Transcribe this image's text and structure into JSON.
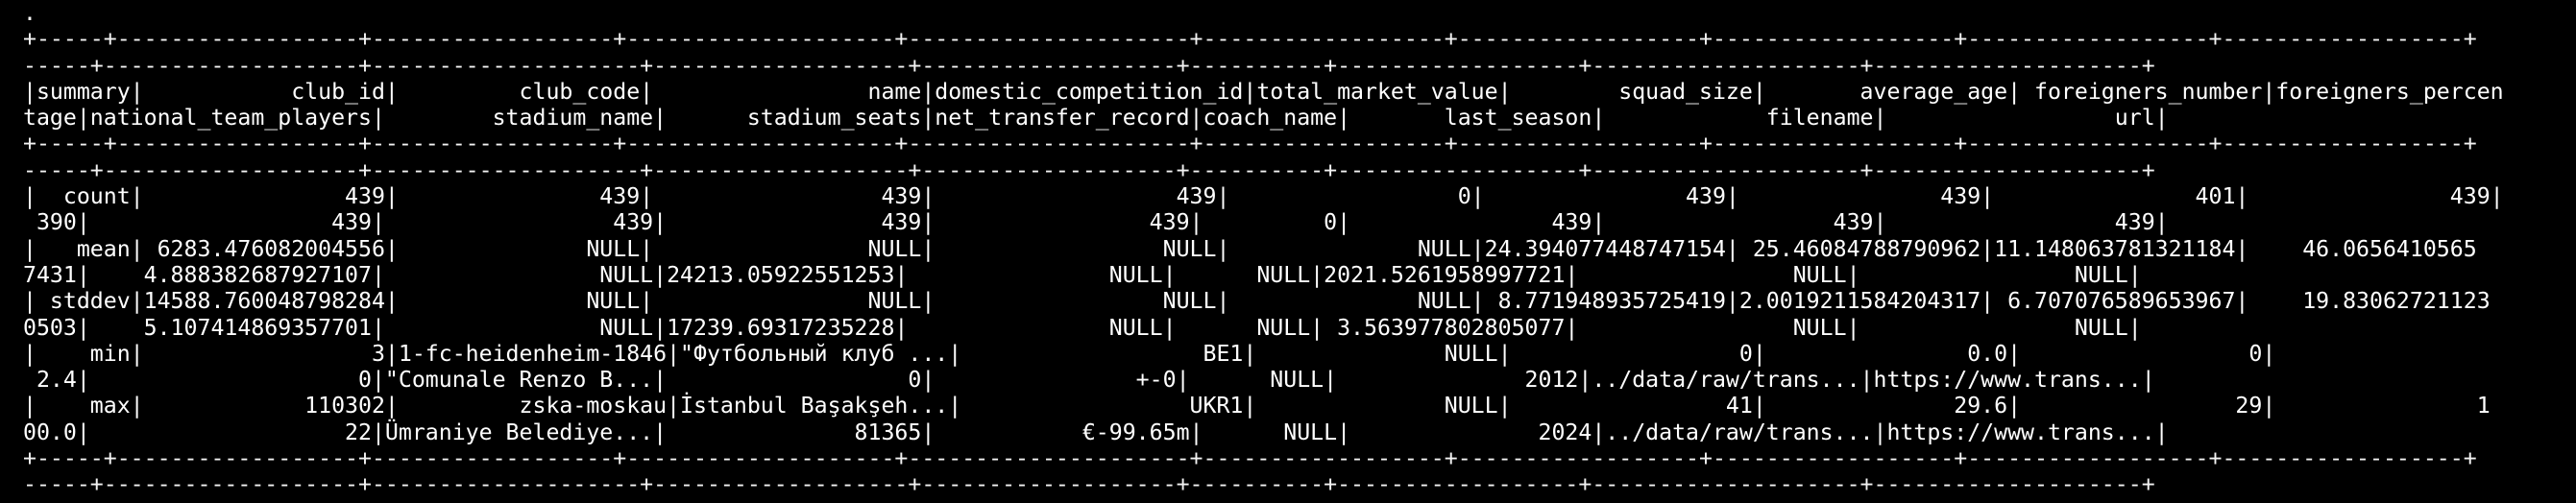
{
  "terminal": {
    "background": "#000000",
    "foreground": "#ffffff",
    "lines": [
      ".",
      "+-----+------------------+------------------+--------------------+---------------------+------------------+------------------+------------------+------------------+------------------+",
      "-----+-------------------+--------------------+-------------------+-------------------+----------+------------------+--------------------+--------------------+",
      "|summary|           club_id|         club_code|                name|domestic_competition_id|total_market_value|        squad_size|       average_age| foreigners_number|foreigners_percen",
      "tage|national_team_players|        stadium_name|      stadium_seats|net_transfer_record|coach_name|       last_season|            filename|                 url|",
      "+-----+------------------+------------------+--------------------+---------------------+------------------+------------------+------------------+------------------+------------------+",
      "-----+-------------------+--------------------+-------------------+-------------------+----------+------------------+--------------------+--------------------+",
      "|  count|               439|               439|                 439|                  439|                 0|               439|               439|               401|               439|",
      " 390|                  439|                 439|                439|                439|         0|               439|                 439|                 439|",
      "|   mean| 6283.476082004556|              NULL|                NULL|                 NULL|              NULL|24.394077448747154| 25.46084788790962|11.148063781321184|    46.0656410565",
      "7431|    4.888382687927107|                NULL|24213.05922551253|               NULL|      NULL|2021.5261958997721|                NULL|                NULL|",
      "| stddev|14588.760048798284|              NULL|                NULL|                 NULL|              NULL| 8.771948935725419|2.0019211584204317| 6.707076589653967|    19.83062721123",
      "0503|    5.107414869357701|                NULL|17239.69317235228|               NULL|      NULL| 3.563977802805077|                NULL|                NULL|",
      "|    min|                 3|1-fc-heidenheim-1846|\"Футбольный клуб ...|                  BE1|              NULL|                 0|               0.0|                 0|",
      " 2.4|                    0|\"Comunale Renzo B...|                  0|               +-0|      NULL|              2012|../data/raw/trans...|https://www.trans...|",
      "|    max|            110302|         zska-moskau|İstanbul Başakşeh...|                 UKR1|              NULL|                41|              29.6|                29|               1",
      "00.0|                   22|Ümraniye Belediye...|              81365|           €-99.65m|      NULL|              2024|../data/raw/trans...|https://www.trans...|",
      "+-----+------------------+------------------+--------------------+---------------------+------------------+------------------+------------------+------------------+------------------+",
      "-----+-------------------+--------------------+-------------------+-------------------+----------+------------------+--------------------+--------------------+"
    ]
  }
}
